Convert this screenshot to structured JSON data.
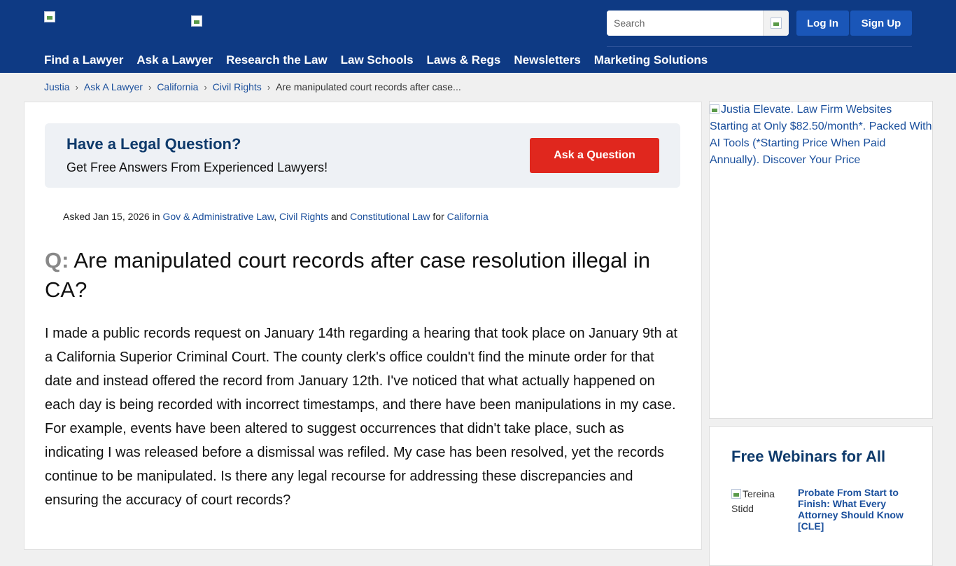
{
  "header": {
    "search_placeholder": "Search",
    "login_label": "Log In",
    "signup_label": "Sign Up",
    "nav": [
      "Find a Lawyer",
      "Ask a Lawyer",
      "Research the Law",
      "Law Schools",
      "Laws & Regs",
      "Newsletters",
      "Marketing Solutions"
    ]
  },
  "breadcrumb": {
    "items": [
      "Justia",
      "Ask A Lawyer",
      "California",
      "Civil Rights"
    ],
    "current": "Are manipulated court records after case..."
  },
  "cta": {
    "title": "Have a Legal Question?",
    "subtitle": "Get Free Answers From Experienced Lawyers!",
    "button": "Ask a Question"
  },
  "meta": {
    "asked": "Asked Jan 15, 2026 in",
    "cat1": "Gov & Administrative Law",
    "comma": ",",
    "cat2": "Civil Rights",
    "and": "and",
    "cat3": "Constitutional Law",
    "for": "for",
    "state": "California"
  },
  "question": {
    "label": "Q:",
    "title": "Are manipulated court records after case resolution illegal in CA?",
    "body": "I made a public records request on January 14th regarding a hearing that took place on January 9th at a California Superior Criminal Court. The county clerk's office couldn't find the minute order for that date and instead offered the record from January 12th. I've noticed that what actually happened on each day is being recorded with incorrect timestamps, and there have been manipulations in my case. For example, events have been altered to suggest occurrences that didn't take place, such as indicating I was released before a dismissal was refiled. My case has been resolved, yet the records continue to be manipulated. Is there any legal recourse for addressing these discrepancies and ensuring the accuracy of court records?"
  },
  "sidebar": {
    "ad_text": "Justia Elevate. Law Firm Websites Starting at Only $82.50/month*. Packed With AI Tools (*Starting Price When Paid Annually). Discover Your Price",
    "webinars_title": "Free Webinars for All",
    "webinar_img_alt": "Tereina Stidd",
    "webinar_link": "Probate From Start to Finish: What Every Attorney Should Know [CLE]"
  },
  "colors": {
    "header_bg": "#0e3a84",
    "link": "#1a4f9c",
    "cta_button": "#e0271e"
  }
}
